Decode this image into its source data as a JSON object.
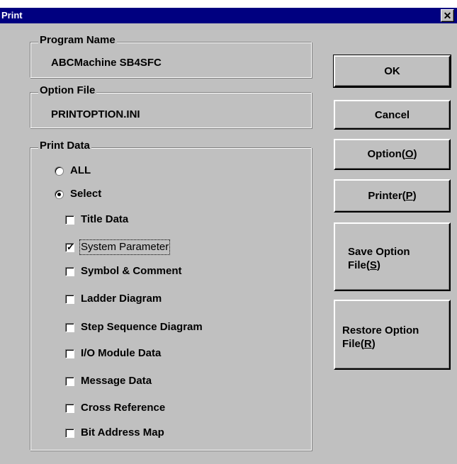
{
  "window": {
    "title": "Print",
    "close_glyph": "✕"
  },
  "program_name": {
    "legend": "Program Name",
    "value": "ABCMachine SB4SFC"
  },
  "option_file": {
    "legend": "Option File",
    "value": "PRINTOPTION.INI"
  },
  "print_data": {
    "legend": "Print Data",
    "radios": [
      {
        "label": "ALL",
        "selected": false
      },
      {
        "label": "Select",
        "selected": true
      }
    ],
    "checkboxes": [
      {
        "label": "Title Data",
        "checked": false
      },
      {
        "label": "System Parameter",
        "checked": true
      },
      {
        "label": "Symbol & Comment",
        "checked": false
      },
      {
        "label": "Ladder Diagram",
        "checked": false
      },
      {
        "label": "Step Sequence Diagram",
        "checked": false
      },
      {
        "label": "I/O Module Data",
        "checked": false
      },
      {
        "label": "Message Data",
        "checked": false
      },
      {
        "label": "Cross Reference",
        "checked": false
      },
      {
        "label": "Bit Address Map",
        "checked": false
      }
    ]
  },
  "buttons": {
    "ok": "OK",
    "cancel": "Cancel",
    "option": {
      "text": "Option(",
      "key": "O",
      "end": ")"
    },
    "printer": {
      "text": "Printer(",
      "key": "P",
      "end": ")"
    },
    "save": {
      "line1": "Save Option",
      "line2": "File(",
      "key": "S",
      "end": ")"
    },
    "restore": {
      "line1": "Restore Option",
      "line2": "File(",
      "key": "R",
      "end": ")"
    }
  }
}
